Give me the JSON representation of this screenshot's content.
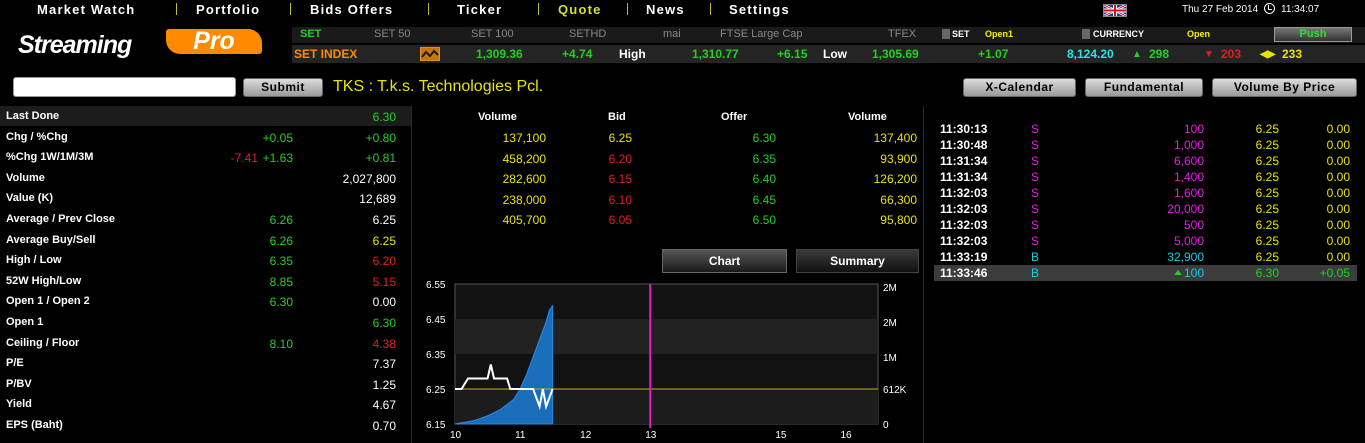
{
  "menu": [
    {
      "label": "Market Watch",
      "active": false
    },
    {
      "label": "Portfolio",
      "active": false
    },
    {
      "label": "Bids Offers",
      "active": false
    },
    {
      "label": "Ticker",
      "active": false
    },
    {
      "label": "Quote",
      "active": true
    },
    {
      "label": "News",
      "active": false
    },
    {
      "label": "Settings",
      "active": false
    }
  ],
  "topbar": {
    "date": "Thu 27 Feb 2014",
    "time": "11:34:07",
    "flag": "uk-flag-icon",
    "clock": "clock-icon"
  },
  "logo": {
    "text1": "Streaming",
    "text2": "Pro"
  },
  "index_tabs": [
    "SET",
    "SET 50",
    "SET 100",
    "SETHD",
    "mai",
    "FTSE Large Cap",
    "TFEX"
  ],
  "market_status": {
    "set_label": "SET",
    "set_status": "Open1",
    "currency_label": "CURRENCY",
    "currency_status": "Open"
  },
  "push_label": "Push",
  "index_row": {
    "name": "SET INDEX",
    "last": "1,309.36",
    "change": "+4.74",
    "high_label": "High",
    "high": "1,310.77",
    "high_chg": "+6.15",
    "low_label": "Low",
    "low": "1,305.69",
    "low_chg": "+1.07",
    "value": "8,124.20",
    "up_count": "298",
    "down_count": "203",
    "unch_count": "233"
  },
  "search": {
    "value": "",
    "submit_label": "Submit"
  },
  "stock_title": "TKS : T.k.s. Technologies Pcl.",
  "buttons": {
    "xcal": "X-Calendar",
    "fund": "Fundamental",
    "vbp": "Volume By Price"
  },
  "stats": [
    {
      "label": "Last Done",
      "v1": "",
      "v2": "6.30",
      "c2": "green"
    },
    {
      "label": "Chg / %Chg",
      "v1": "+0.05",
      "c1": "green",
      "v2": "+0.80",
      "c2": "green"
    },
    {
      "label": "%Chg 1W/1M/3M",
      "v0": "-7.41",
      "c0": "red",
      "v1": "+1.63",
      "c1": "green",
      "v2": "+0.81",
      "c2": "green"
    },
    {
      "label": "Volume",
      "v1": "",
      "v2": "2,027,800",
      "c2": "white"
    },
    {
      "label": "Value (K)",
      "v1": "",
      "v2": "12,689",
      "c2": "white"
    },
    {
      "label": "Average / Prev Close",
      "v1": "6.26",
      "c1": "green",
      "v2": "6.25",
      "c2": "white"
    },
    {
      "label": "Average Buy/Sell",
      "v1": "6.26",
      "c1": "green",
      "v2": "6.25",
      "c2": "yellow"
    },
    {
      "label": "High / Low",
      "v1": "6.35",
      "c1": "green",
      "v2": "6.20",
      "c2": "red"
    },
    {
      "label": "52W High/Low",
      "v1": "8.85",
      "c1": "green",
      "v2": "5.15",
      "c2": "red"
    },
    {
      "label": "Open 1 / Open 2",
      "v1": "6.30",
      "c1": "green",
      "v2": "0.00",
      "c2": "white"
    },
    {
      "label": "Open 1",
      "v1": "",
      "v2": "6.30",
      "c2": "green"
    },
    {
      "label": "Ceiling / Floor",
      "v1": "8.10",
      "c1": "green",
      "v2": "4.38",
      "c2": "red"
    },
    {
      "label": "P/E",
      "v1": "",
      "v2": "7.37",
      "c2": "white"
    },
    {
      "label": "P/BV",
      "v1": "",
      "v2": "1.25",
      "c2": "white"
    },
    {
      "label": "Yield",
      "v1": "",
      "v2": "4.67",
      "c2": "white"
    },
    {
      "label": "EPS (Baht)",
      "v1": "",
      "v2": "0.70",
      "c2": "white"
    }
  ],
  "bidoffer": {
    "headers": [
      "Volume",
      "Bid",
      "Offer",
      "Volume"
    ],
    "rows": [
      {
        "bvol": "137,100",
        "bid": "6.25",
        "bidc": "yellow",
        "offer": "6.30",
        "ovol": "137,400"
      },
      {
        "bvol": "458,200",
        "bid": "6.20",
        "bidc": "red",
        "offer": "6.35",
        "ovol": "93,900"
      },
      {
        "bvol": "282,600",
        "bid": "6.15",
        "bidc": "red",
        "offer": "6.40",
        "ovol": "126,200"
      },
      {
        "bvol": "238,000",
        "bid": "6.10",
        "bidc": "red",
        "offer": "6.45",
        "ovol": "66,300"
      },
      {
        "bvol": "405,700",
        "bid": "6.05",
        "bidc": "red",
        "offer": "6.50",
        "ovol": "95,800"
      }
    ]
  },
  "tabs": {
    "chart": "Chart",
    "summary": "Summary"
  },
  "chart_data": {
    "type": "line",
    "left_axis_ticks": [
      "6.55",
      "6.45",
      "6.35",
      "6.25",
      "6.15"
    ],
    "right_axis_ticks": [
      "2M",
      "2M",
      "1M",
      "612K",
      "0"
    ],
    "x_ticks": [
      "10",
      "11",
      "12",
      "13",
      "15",
      "16"
    ],
    "price_line": {
      "x": [
        10.0,
        10.1,
        10.2,
        10.4,
        10.5,
        10.55,
        10.6,
        10.7,
        10.8,
        10.85,
        10.9,
        11.0,
        11.2,
        11.3,
        11.35,
        11.4,
        11.5
      ],
      "y": [
        6.25,
        6.25,
        6.28,
        6.28,
        6.28,
        6.32,
        6.28,
        6.28,
        6.28,
        6.25,
        6.25,
        6.25,
        6.25,
        6.2,
        6.25,
        6.2,
        6.25
      ]
    },
    "volume_area": {
      "x": [
        10.0,
        10.3,
        10.5,
        10.7,
        10.9,
        11.0,
        11.1,
        11.2,
        11.3,
        11.4,
        11.45,
        11.5
      ],
      "y": [
        0,
        60000,
        140000,
        250000,
        420000,
        600000,
        850000,
        1150000,
        1450000,
        1750000,
        1950000,
        2027800
      ]
    },
    "prev_close_line": 6.25,
    "marker_x": 13.0,
    "ylim": [
      6.15,
      6.55
    ],
    "y2lim": [
      0,
      2400000
    ],
    "xlim": [
      10,
      16.5
    ]
  },
  "ticker": [
    {
      "time": "11:30:13",
      "side": "S",
      "vol": "100",
      "price": "6.25",
      "chg": "0.00"
    },
    {
      "time": "11:30:48",
      "side": "S",
      "vol": "1,000",
      "price": "6.25",
      "chg": "0.00"
    },
    {
      "time": "11:31:34",
      "side": "S",
      "vol": "6,600",
      "price": "6.25",
      "chg": "0.00"
    },
    {
      "time": "11:31:34",
      "side": "S",
      "vol": "1,400",
      "price": "6.25",
      "chg": "0.00"
    },
    {
      "time": "11:32:03",
      "side": "S",
      "vol": "1,600",
      "price": "6.25",
      "chg": "0.00"
    },
    {
      "time": "11:32:03",
      "side": "S",
      "vol": "20,000",
      "price": "6.25",
      "chg": "0.00"
    },
    {
      "time": "11:32:03",
      "side": "S",
      "vol": "500",
      "price": "6.25",
      "chg": "0.00"
    },
    {
      "time": "11:32:03",
      "side": "S",
      "vol": "5,000",
      "price": "6.25",
      "chg": "0.00"
    },
    {
      "time": "11:33:19",
      "side": "B",
      "vol": "32,900",
      "price": "6.25",
      "chg": "0.00"
    },
    {
      "time": "11:33:46",
      "side": "B",
      "vol": "100",
      "price": "6.30",
      "chg": "+0.05",
      "highlight": true
    }
  ]
}
